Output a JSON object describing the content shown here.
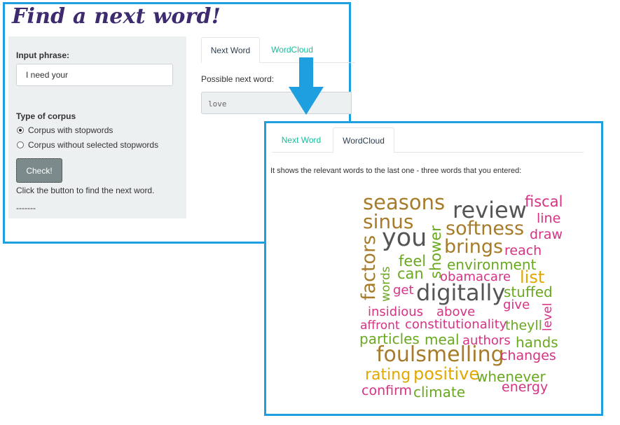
{
  "app": {
    "title": "Find a next word!"
  },
  "sidebar": {
    "input_label": "Input phrase:",
    "input_value": "I need your",
    "corpus_label": "Type of corpus",
    "options": [
      "Corpus with stopwords",
      "Corpus without selected stopwords"
    ],
    "selected_option": "Corpus with stopwords",
    "button_label": "Check!",
    "hint": "Click the button to find the next word.",
    "separator": "-------"
  },
  "main": {
    "tabs": [
      {
        "label": "Next Word",
        "active": true
      },
      {
        "label": "WordCloud",
        "active": false
      }
    ],
    "output_label": "Possible next word:",
    "output_value": "love"
  },
  "wordcloud_view": {
    "tabs": [
      {
        "label": "Next Word",
        "active": false
      },
      {
        "label": "WordCloud",
        "active": true
      }
    ],
    "description": "It shows the relevant words to the last one - three words that you entered:",
    "words": [
      {
        "text": "seasons",
        "color": "#a67c2a"
      },
      {
        "text": "review",
        "color": "#555555"
      },
      {
        "text": "fiscal",
        "color": "#d63384"
      },
      {
        "text": "sinus",
        "color": "#a67c2a"
      },
      {
        "text": "line",
        "color": "#d63384"
      },
      {
        "text": "softness",
        "color": "#a67c2a"
      },
      {
        "text": "you",
        "color": "#555555"
      },
      {
        "text": "draw",
        "color": "#d63384"
      },
      {
        "text": "shower",
        "color": "#6aa820"
      },
      {
        "text": "brings",
        "color": "#a67c2a"
      },
      {
        "text": "factors",
        "color": "#a67c2a"
      },
      {
        "text": "reach",
        "color": "#d63384"
      },
      {
        "text": "feel",
        "color": "#6aa820"
      },
      {
        "text": "environment",
        "color": "#6aa820"
      },
      {
        "text": "words",
        "color": "#6aa820"
      },
      {
        "text": "can",
        "color": "#6aa820"
      },
      {
        "text": "obamacare",
        "color": "#d63384"
      },
      {
        "text": "list",
        "color": "#e0a800"
      },
      {
        "text": "get",
        "color": "#d63384"
      },
      {
        "text": "digitally",
        "color": "#555555"
      },
      {
        "text": "stuffed",
        "color": "#6aa820"
      },
      {
        "text": "give",
        "color": "#d63384"
      },
      {
        "text": "insidious",
        "color": "#d63384"
      },
      {
        "text": "above",
        "color": "#d63384"
      },
      {
        "text": "level",
        "color": "#d63384"
      },
      {
        "text": "affront",
        "color": "#d63384"
      },
      {
        "text": "constitutionality",
        "color": "#d63384"
      },
      {
        "text": "theyll",
        "color": "#6aa820"
      },
      {
        "text": "particles",
        "color": "#6aa820"
      },
      {
        "text": "meal",
        "color": "#6aa820"
      },
      {
        "text": "authors",
        "color": "#d63384"
      },
      {
        "text": "hands",
        "color": "#6aa820"
      },
      {
        "text": "foulsmelling",
        "color": "#a67c2a"
      },
      {
        "text": "changes",
        "color": "#d63384"
      },
      {
        "text": "rating",
        "color": "#e0a800"
      },
      {
        "text": "positive",
        "color": "#e0a800"
      },
      {
        "text": "whenever",
        "color": "#6aa820"
      },
      {
        "text": "confirm",
        "color": "#d63384"
      },
      {
        "text": "climate",
        "color": "#6aa820"
      },
      {
        "text": "energy",
        "color": "#d63384"
      }
    ]
  },
  "colors": {
    "accent_border": "#1ea0e0",
    "title": "#3e2a6e",
    "link": "#18bc9c",
    "button": "#7b8a8b"
  }
}
